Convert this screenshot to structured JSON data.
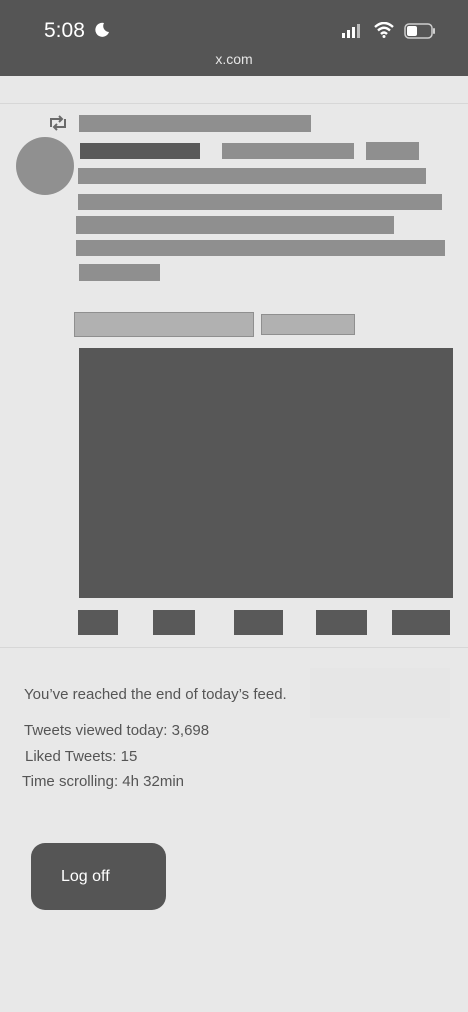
{
  "status_bar": {
    "time": "5:08",
    "url": "x.com",
    "icons": [
      "moon-icon",
      "signal-icon",
      "wifi-icon",
      "battery-icon"
    ]
  },
  "feed_end": {
    "message": "You’ve reached the end of today’s feed.",
    "tweets_viewed": "Tweets viewed today: 3,698",
    "liked_tweets": "Liked Tweets: 15",
    "time_scrolling": "Time scrolling: 4h 32min",
    "logoff_label": "Log off"
  },
  "colors": {
    "header_bg": "#555555",
    "page_bg": "#e8e8e8",
    "redaction": "#8f8f8f",
    "button_bg": "#555555"
  }
}
